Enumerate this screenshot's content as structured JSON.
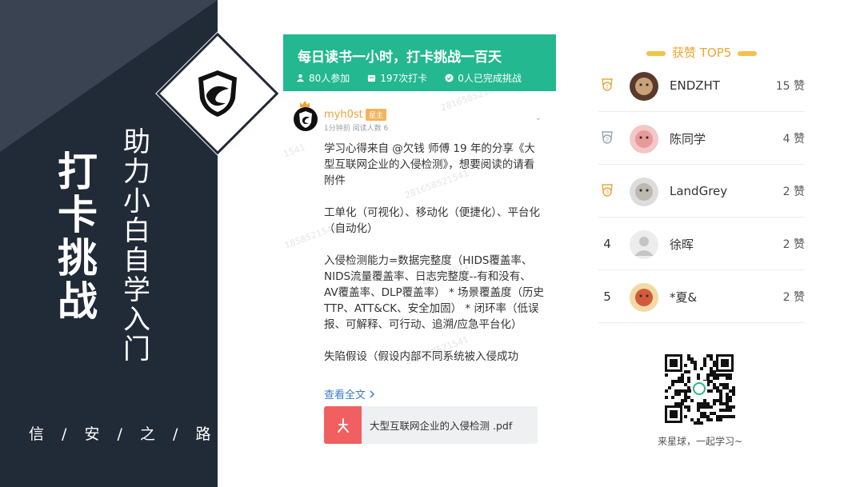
{
  "left": {
    "vertical_title": "打卡挑战",
    "vertical_subtitle": "助力小白自学入门",
    "bottom_text": "信 / 安 / 之 / 路"
  },
  "challenge": {
    "title": "每日读书一小时，打卡挑战一百天",
    "stats": [
      {
        "icon": "people-icon",
        "text": "80人参加"
      },
      {
        "icon": "checkin-icon",
        "text": "197次打卡"
      },
      {
        "icon": "check-circle-icon",
        "text": "0人已完成挑战"
      }
    ]
  },
  "post": {
    "author": "myh0st",
    "badge": "星主",
    "meta": "1分钟前  阅读人数 6",
    "paragraphs": [
      "学习心得来自 @欠钱 师傅 19 年的分享《大型互联网企业的入侵检测》，想要阅读的请看附件",
      "工单化（可视化）、移动化（便捷化）、平台化（自动化）",
      "入侵检测能力=数据完整度（HIDS覆盖率、NIDS流量覆盖率、日志完整度--有和没有、AV覆盖率、DLP覆盖率） * 场景覆盖度（历史TTP、ATT&CK、安全加固） * 闭环率（低误报、可解释、可行动、追溯/应急平台化）",
      "失陷假设（假设内部不同系统被入侵成功"
    ],
    "read_more": "查看全文",
    "attachment": "大型互联网企业的入侵检测 .pdf",
    "watermarks": [
      "28165852154",
      "281658521541",
      "1858521541",
      "281658521541",
      "281658521541",
      "1541"
    ]
  },
  "ranking": {
    "title": "获赞 TOP5",
    "rows": [
      {
        "rank": "1",
        "name": "ENDZHT",
        "likes": "15 赞",
        "medal": true
      },
      {
        "rank": "2",
        "name": "陈同学",
        "likes": "4 赞",
        "medal": true
      },
      {
        "rank": "3",
        "name": "LandGrey",
        "likes": "2 赞",
        "medal": true
      },
      {
        "rank": "4",
        "name": "徐晖",
        "likes": "2 赞",
        "medal": false
      },
      {
        "rank": "5",
        "name": "*夏&",
        "likes": "2 赞",
        "medal": false
      }
    ]
  },
  "qr_caption": "来星球，一起学习~",
  "colors": {
    "dark": "#212a37",
    "green": "#23b88f",
    "orange": "#f0a531",
    "link": "#3b7cc9",
    "pdf": "#f06060"
  }
}
